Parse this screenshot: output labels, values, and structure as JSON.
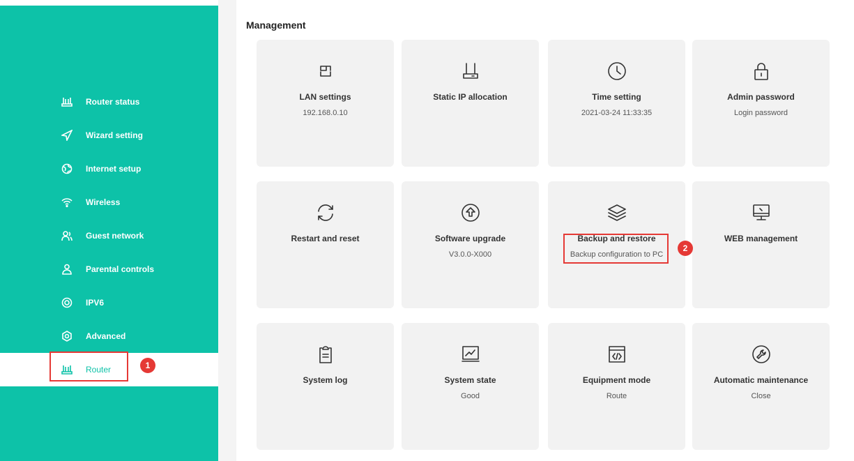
{
  "sidebar": {
    "items": [
      {
        "label": "Router status",
        "icon": "router-status-icon"
      },
      {
        "label": "Wizard setting",
        "icon": "navigation-arrow-icon"
      },
      {
        "label": "Internet setup",
        "icon": "globe-icon"
      },
      {
        "label": "Wireless",
        "icon": "wifi-icon"
      },
      {
        "label": "Guest network",
        "icon": "guest-users-icon"
      },
      {
        "label": "Parental controls",
        "icon": "parental-user-icon"
      },
      {
        "label": "IPV6",
        "icon": "ipv6-icon"
      },
      {
        "label": "Advanced",
        "icon": "advanced-settings-icon"
      },
      {
        "label": "Router",
        "icon": "router-icon",
        "active": true
      }
    ]
  },
  "main": {
    "section_title": "Management",
    "cards": [
      {
        "title": "LAN settings",
        "subtitle": "192.168.0.10",
        "icon": "lan-icon"
      },
      {
        "title": "Static IP allocation",
        "subtitle": "",
        "icon": "static-ip-icon"
      },
      {
        "title": "Time setting",
        "subtitle": "2021-03-24 11:33:35",
        "icon": "clock-icon"
      },
      {
        "title": "Admin password",
        "subtitle": "Login password",
        "icon": "lock-icon"
      },
      {
        "title": "Restart and reset",
        "subtitle": "",
        "icon": "restart-icon"
      },
      {
        "title": "Software upgrade",
        "subtitle": "V3.0.0-X000",
        "icon": "upgrade-icon"
      },
      {
        "title": "Backup and restore",
        "subtitle": "Backup configuration to PC",
        "icon": "layers-icon"
      },
      {
        "title": "WEB management",
        "subtitle": "",
        "icon": "monitor-icon"
      },
      {
        "title": "System log",
        "subtitle": "",
        "icon": "clipboard-icon"
      },
      {
        "title": "System state",
        "subtitle": "Good",
        "icon": "chart-icon"
      },
      {
        "title": "Equipment mode",
        "subtitle": "Route",
        "icon": "code-window-icon"
      },
      {
        "title": "Automatic maintenance",
        "subtitle": "Close",
        "icon": "wrench-icon"
      }
    ]
  },
  "annotations": {
    "step1": "1",
    "step2": "2"
  },
  "colors": {
    "accent": "#0dc2a8",
    "highlight": "#e53935",
    "card_bg": "#f2f2f2"
  }
}
